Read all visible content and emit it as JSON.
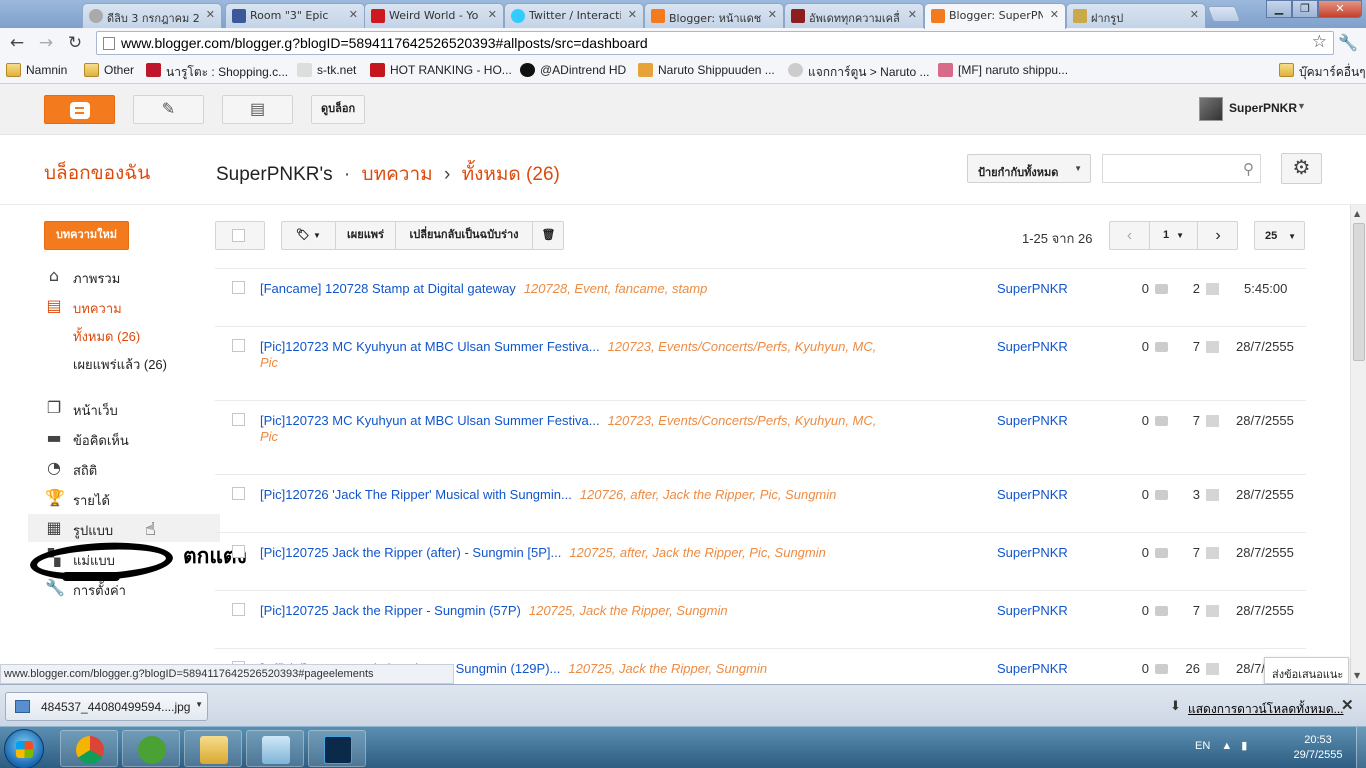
{
  "browser": {
    "tabs": [
      {
        "label": "ดีลิบ 3 กรกฎาคม 25",
        "icon": "globe-icon",
        "color": "#888888"
      },
      {
        "label": "Room \"3\" Epic",
        "icon": "facebook-icon",
        "color": "#3b5998"
      },
      {
        "label": "Weird World - Yo",
        "icon": "youtube-icon",
        "color": "#cc181e"
      },
      {
        "label": "Twitter / Interacti",
        "icon": "twitter-icon",
        "color": "#33ccff"
      },
      {
        "label": "Blogger: หน้าแดช",
        "icon": "blogger-icon",
        "color": "#f37b1d"
      },
      {
        "label": "อัพเดททุกความเคลื่",
        "icon": "site-icon",
        "color": "#8b1e1e"
      },
      {
        "label": "Blogger: SuperPN",
        "icon": "blogger-icon",
        "color": "#f37b1d"
      },
      {
        "label": "ฝากรูป",
        "icon": "picture-icon",
        "color": "#c9a94a"
      }
    ],
    "url": "www.blogger.com/blogger.g?blogID=5894117642526520393#allposts/src=dashboard",
    "bookmarks": [
      {
        "label": "Namnin",
        "icon": "folder-icon"
      },
      {
        "label": "Other",
        "icon": "folder-icon"
      },
      {
        "label": "นารูโตะ : Shopping.c...",
        "icon": "shop-icon"
      },
      {
        "label": "s-tk.net",
        "icon": "stk-icon"
      },
      {
        "label": "HOT RANKING - HO...",
        "icon": "ranking-icon"
      },
      {
        "label": "@ADintrend HD",
        "icon": "adintrend-icon"
      },
      {
        "label": "Naruto Shippuuden ...",
        "icon": "naruto-icon"
      },
      {
        "label": "แจกการ์ตูน > Naruto ...",
        "icon": "globe-icon"
      },
      {
        "label": "[MF] naruto shippu...",
        "icon": "mf-icon"
      }
    ],
    "other_bookmarks": "บุ๊คมาร์คอื่นๆ"
  },
  "blogger": {
    "view_blog_button": "ดูบล็อก",
    "user_name": "SuperPNKR",
    "my_blogs": "บล็อกของฉัน",
    "blog_name": "SuperPNKR's",
    "crumb_sep": "·",
    "crumb_section": "บทความ",
    "crumb_arrow": "›",
    "crumb_all": "ทั้งหมด (26)",
    "labels_select": "ป้ายกำกับทั้งหมด",
    "new_post": "บทความใหม่",
    "sidebar": [
      {
        "label": "ภาพรวม",
        "icon": "home-icon"
      },
      {
        "label": "บทความ",
        "icon": "posts-icon"
      },
      {
        "label": "หน้าเว็บ",
        "icon": "pages-icon"
      },
      {
        "label": "ข้อคิดเห็น",
        "icon": "comments-icon"
      },
      {
        "label": "สถิติ",
        "icon": "stats-icon"
      },
      {
        "label": "รายได้",
        "icon": "earnings-icon"
      },
      {
        "label": "รูปแบบ",
        "icon": "layout-icon"
      },
      {
        "label": "แม่แบบ",
        "icon": "template-icon"
      },
      {
        "label": "การตั้งค่า",
        "icon": "settings-icon"
      }
    ],
    "sub_all": "ทั้งหมด (26)",
    "sub_published": "เผยแพร่แล้ว (26)",
    "annotation": "ตกแต่ง",
    "toolbar": {
      "publish": "เผยแพร่",
      "revert": "เปลี่ยนกลับเป็นฉบับร่าง"
    },
    "range": "1-25 จาก 26",
    "page": "1",
    "per_page": "25",
    "posts": [
      {
        "title": "[Fancame] 120728 Stamp at Digital gateway",
        "labels": "120728, Event, fancame, stamp",
        "author": "SuperPNKR",
        "comments": "0",
        "views": "2",
        "date": "5:45:00"
      },
      {
        "title": "[Pic]120723 MC Kyuhyun at MBC Ulsan Summer Festiva...",
        "labels": "120723, Events/Concerts/Perfs, Kyuhyun, MC, Pic",
        "author": "SuperPNKR",
        "comments": "0",
        "views": "7",
        "date": "28/7/2555"
      },
      {
        "title": "[Pic]120723 MC Kyuhyun at MBC Ulsan Summer Festiva...",
        "labels": "120723, Events/Concerts/Perfs, Kyuhyun, MC, Pic",
        "author": "SuperPNKR",
        "comments": "0",
        "views": "7",
        "date": "28/7/2555"
      },
      {
        "title": "[Pic]120726 'Jack The Ripper' Musical with Sungmin...",
        "labels": "120726, after, Jack the Ripper, Pic, Sungmin",
        "author": "SuperPNKR",
        "comments": "0",
        "views": "3",
        "date": "28/7/2555"
      },
      {
        "title": "[Pic]120725 Jack the Ripper (after) - Sungmin [5P]...",
        "labels": "120725, after, Jack the Ripper, Pic, Sungmin",
        "author": "SuperPNKR",
        "comments": "0",
        "views": "7",
        "date": "28/7/2555"
      },
      {
        "title": "[Pic]120725 Jack the Ripper - Sungmin (57P)",
        "labels": "120725, Jack the Ripper, Sungmin",
        "author": "SuperPNKR",
        "comments": "0",
        "views": "7",
        "date": "28/7/2555"
      },
      {
        "title": "[Official]120725 Jack the Ripper - Sungmin (129P)...",
        "labels": "120725, Jack the Ripper, Sungmin",
        "author": "SuperPNKR",
        "comments": "0",
        "views": "26",
        "date": "28/7/2555"
      }
    ],
    "status_url": "www.blogger.com/blogger.g?blogID=5894117642526520393#pageelements",
    "feedback": "ส่งข้อเสนอแนะ"
  },
  "downloads": {
    "file": "484537_44080499594....jpg",
    "show_all": "แสดงการดาวน์โหลดทั้งหมด..."
  },
  "taskbar": {
    "lang": "EN",
    "time": "20:53",
    "date": "29/7/2555"
  },
  "colors": {
    "blogger_orange": "#f37b1d",
    "link_blue": "#1155cc",
    "label_orange": "#ed8b43"
  }
}
